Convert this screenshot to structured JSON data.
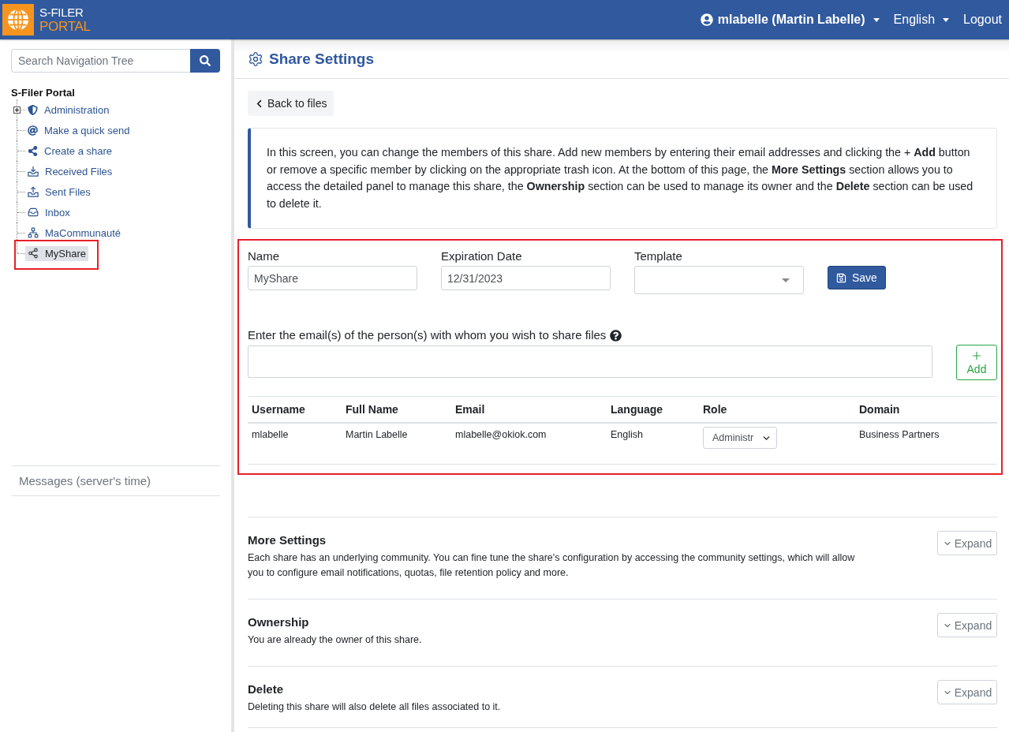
{
  "header": {
    "logo": {
      "line_1": "S-FILER",
      "line_2": "PORTAL"
    },
    "user_menu": "mlabelle (Martin Labelle)",
    "language_menu": "English",
    "logout": "Logout"
  },
  "sidebar": {
    "search": {
      "placeholder": "Search Navigation Tree"
    },
    "tree": {
      "label": "S-Filer Portal",
      "children": [
        {
          "label": "Administration",
          "kind": "shield",
          "expanded": false,
          "selected": false,
          "highlighted": false
        },
        {
          "label": "Make a quick send",
          "kind": "at",
          "selected": false,
          "highlighted": false
        },
        {
          "label": "Create a share",
          "kind": "share",
          "selected": false,
          "highlighted": false
        },
        {
          "label": "Received Files",
          "kind": "download",
          "selected": false,
          "highlighted": false
        },
        {
          "label": "Sent Files",
          "kind": "upload",
          "selected": false,
          "highlighted": false
        },
        {
          "label": "Inbox",
          "kind": "inbox",
          "selected": false,
          "highlighted": false
        },
        {
          "label": "MaCommunauté",
          "kind": "sitemap",
          "selected": false,
          "highlighted": false
        },
        {
          "label": "MyShare",
          "kind": "nodes",
          "selected": true,
          "highlighted": true
        }
      ]
    },
    "messages": {
      "title": "Messages (server's time)"
    }
  },
  "page": {
    "title": "Share Settings",
    "back_button": "Back to files",
    "info": "In this screen, you can change the members of this share. Add new members by entering their email addresses and clicking the + **Add** button or remove a specific member by clicking on the appropriate trash icon. At the bottom of this page, the **More Settings** section allows you to access the detailed panel to manage this share, the **Ownership** section can be used to manage its owner and the **Delete** section can be used to delete it."
  },
  "share_form": {
    "highlighted": true,
    "fields": [
      {
        "kind": "text",
        "label": "Name",
        "value": "MyShare"
      },
      {
        "kind": "text",
        "label": "Expiration Date",
        "value": "12/31/2023"
      },
      {
        "kind": "select",
        "label": "Template"
      }
    ],
    "save_button": "Save",
    "email": {
      "label": "Enter the email(s) of the person(s) with whom you wish to share files",
      "add_button": "Add"
    },
    "members_table": {
      "columns": [
        "Username",
        "Full Name",
        "Email",
        "Language",
        "Role",
        "Domain"
      ],
      "rows": [
        {
          "username": "mlabelle",
          "full_name": "Martin Labelle",
          "email": "mlabelle@okiok.com",
          "language": "English",
          "role": "Administr",
          "domain": "Business Partners"
        }
      ]
    }
  },
  "sections": [
    {
      "title": "More Settings",
      "description": "Each share has an underlying community. You can fine tune the share's configuration by accessing the community settings, which will allow you to configure email notifications, quotas, file retention policy and more.",
      "button": "Expand",
      "expanded": false
    },
    {
      "title": "Ownership",
      "description": "You are already the owner of this share.",
      "button": "Expand",
      "expanded": false
    },
    {
      "title": "Delete",
      "description": "Deleting this share will also delete all files associated to it.",
      "button": "Expand",
      "expanded": false
    }
  ]
}
